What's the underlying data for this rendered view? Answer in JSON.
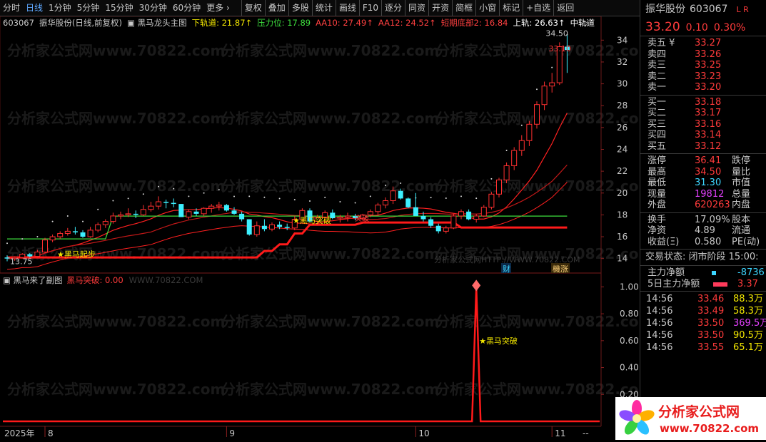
{
  "toolbar": {
    "left": [
      "分时",
      "日线",
      "1分钟",
      "5分钟",
      "15分钟",
      "30分钟",
      "60分钟",
      "更多 ›"
    ],
    "right": [
      "复权",
      "叠加",
      "多股",
      "统计",
      "画线",
      "F10",
      "逐分",
      "同资",
      "开资",
      "简框",
      "小窗",
      "标记",
      "+自选",
      "返回"
    ]
  },
  "main": {
    "code": "603067",
    "header_parts": [
      {
        "t": "603067",
        "c": "#c8c8c8"
      },
      {
        "t": "振华股份(日线,前复权)",
        "c": "#c8c8c8"
      },
      {
        "t": "▣ 黑马龙头主图",
        "c": "#c8c8c8"
      },
      {
        "t": "下轨道: 21.87↑",
        "c": "#f2e600"
      },
      {
        "t": "压力位: 17.89",
        "c": "#3ee03e"
      },
      {
        "t": "AA10: 27.49↑",
        "c": "#ff4040"
      },
      {
        "t": "AA12: 24.52↑",
        "c": "#ff4040"
      },
      {
        "t": "短期底部2: 16.84",
        "c": "#ff4040"
      },
      {
        "t": "上轨: 26.63↑",
        "c": "#ffffff"
      },
      {
        "t": "中轨道",
        "c": "#ffffff"
      }
    ],
    "y_ticks": [
      34,
      32,
      30,
      28,
      26,
      24,
      22,
      20,
      18,
      16,
      14
    ],
    "labels": {
      "high": "34.50",
      "low": "13.75",
      "last": "33.10",
      "qibu": "★黑马起步",
      "tupo": "★黑马突破",
      "tupo2": "突破",
      "site": "分析家公式网HTTP://WWW.70822.COM",
      "cai": "财",
      "zhang": "機涨"
    }
  },
  "sub": {
    "title": "▣ 黑马来了副图",
    "value_label": "黑马突破: 0.00",
    "site": "WWW.70822.COM",
    "y_ticks": [
      "1.00",
      "0.80",
      "0.60",
      "0.40",
      "0.20"
    ],
    "signal_label": "★黑马突破"
  },
  "xaxis": {
    "year": "2025年",
    "months": [
      "8",
      "9",
      "10",
      "11"
    ],
    "right": "--"
  },
  "watermark": "分析家公式网www.70822.com",
  "chart_data": {
    "type": "candlestick",
    "x_range_note": "2025年 8月-11月 日线",
    "ylim": [
      13,
      35
    ],
    "candles": [
      [
        14.1,
        14.3,
        13.75,
        14.0
      ],
      [
        14.0,
        14.2,
        13.8,
        14.1
      ],
      [
        14.1,
        14.5,
        14.0,
        14.4
      ],
      [
        14.4,
        14.5,
        14.1,
        14.2
      ],
      [
        14.2,
        14.8,
        14.1,
        14.6
      ],
      [
        14.6,
        15.9,
        14.5,
        15.7
      ],
      [
        15.7,
        16.2,
        15.5,
        16.0
      ],
      [
        16.0,
        16.5,
        15.8,
        16.3
      ],
      [
        16.3,
        16.8,
        16.1,
        16.5
      ],
      [
        16.5,
        16.9,
        16.2,
        16.4
      ],
      [
        16.4,
        16.6,
        15.9,
        16.0
      ],
      [
        16.0,
        16.9,
        15.9,
        16.6
      ],
      [
        16.6,
        17.3,
        16.4,
        17.1
      ],
      [
        17.1,
        17.6,
        16.8,
        17.4
      ],
      [
        17.4,
        18.2,
        17.2,
        17.9
      ],
      [
        17.9,
        18.3,
        17.6,
        18.0
      ],
      [
        18.0,
        18.6,
        17.8,
        18.1
      ],
      [
        18.1,
        18.4,
        17.7,
        18.0
      ],
      [
        18.0,
        18.9,
        17.9,
        18.5
      ],
      [
        18.5,
        19.2,
        18.3,
        18.8
      ],
      [
        18.8,
        19.7,
        18.5,
        19.2
      ],
      [
        19.2,
        19.4,
        18.6,
        19.1
      ],
      [
        19.1,
        19.5,
        18.7,
        19.0
      ],
      [
        19.0,
        19.0,
        17.8,
        17.8
      ],
      [
        17.8,
        18.5,
        17.6,
        18.3
      ],
      [
        18.3,
        18.6,
        17.9,
        18.1
      ],
      [
        18.1,
        18.7,
        17.9,
        18.6
      ],
      [
        18.6,
        19.0,
        18.2,
        18.8
      ],
      [
        18.8,
        19.2,
        18.4,
        18.9
      ],
      [
        18.9,
        19.0,
        18.3,
        18.4
      ],
      [
        18.4,
        18.7,
        18.0,
        18.1
      ],
      [
        18.1,
        18.3,
        17.4,
        17.6
      ],
      [
        17.6,
        17.6,
        16.1,
        16.2
      ],
      [
        16.2,
        17.4,
        16.0,
        17.0
      ],
      [
        17.0,
        17.6,
        16.5,
        16.7
      ],
      [
        16.7,
        17.3,
        16.5,
        17.1
      ],
      [
        17.1,
        17.4,
        16.7,
        16.9
      ],
      [
        16.9,
        17.2,
        16.6,
        16.8
      ],
      [
        16.8,
        17.9,
        16.6,
        17.6
      ],
      [
        17.6,
        18.6,
        17.4,
        18.4
      ],
      [
        18.4,
        18.6,
        17.3,
        17.4
      ],
      [
        17.4,
        18.0,
        17.1,
        17.8
      ],
      [
        17.8,
        18.4,
        17.5,
        18.2
      ],
      [
        18.2,
        18.5,
        17.6,
        17.7
      ],
      [
        17.7,
        18.0,
        17.3,
        17.8
      ],
      [
        17.8,
        18.2,
        17.4,
        17.9
      ],
      [
        17.9,
        18.1,
        17.5,
        17.7
      ],
      [
        17.7,
        18.1,
        17.5,
        18.0
      ],
      [
        18.0,
        18.5,
        17.8,
        18.3
      ],
      [
        18.3,
        19.1,
        18.0,
        18.9
      ],
      [
        18.9,
        19.6,
        18.6,
        19.3
      ],
      [
        19.3,
        20.6,
        19.0,
        20.2
      ],
      [
        20.2,
        20.4,
        19.4,
        19.5
      ],
      [
        19.5,
        19.6,
        18.6,
        18.7
      ],
      [
        18.7,
        20.0,
        18.0,
        17.9
      ],
      [
        17.9,
        18.3,
        17.4,
        17.6
      ],
      [
        17.6,
        17.8,
        16.8,
        17.0
      ],
      [
        17.0,
        17.2,
        16.3,
        16.5
      ],
      [
        16.5,
        17.0,
        16.3,
        16.8
      ],
      [
        16.8,
        18.1,
        16.7,
        17.9
      ],
      [
        17.9,
        18.5,
        17.6,
        18.3
      ],
      [
        18.3,
        18.5,
        17.5,
        17.6
      ],
      [
        17.6,
        18.1,
        17.3,
        17.9
      ],
      [
        17.9,
        18.9,
        17.8,
        18.7
      ],
      [
        18.7,
        20.1,
        18.5,
        19.9
      ],
      [
        19.9,
        21.4,
        19.6,
        21.2
      ],
      [
        21.2,
        22.8,
        20.9,
        22.5
      ],
      [
        22.5,
        24.2,
        22.1,
        23.9
      ],
      [
        23.9,
        25.3,
        23.4,
        24.8
      ],
      [
        24.8,
        26.6,
        24.3,
        26.3
      ],
      [
        26.3,
        28.4,
        25.9,
        28.1
      ],
      [
        28.1,
        30.2,
        27.6,
        29.8
      ],
      [
        29.8,
        31.0,
        29.2,
        30.1
      ],
      [
        30.1,
        33.8,
        29.9,
        33.4
      ],
      [
        33.4,
        34.5,
        31.0,
        33.1
      ]
    ],
    "series": [
      {
        "name": "下轨道",
        "value_last": 21.87
      },
      {
        "name": "压力位",
        "value_last": 17.89
      },
      {
        "name": "AA10",
        "value_last": 27.49
      },
      {
        "name": "AA12",
        "value_last": 24.52
      },
      {
        "name": "短期底部2",
        "value_last": 16.84
      },
      {
        "name": "上轨",
        "value_last": 26.63
      }
    ],
    "sub_chart": {
      "name": "黑马突破",
      "spike_index": 62,
      "spike_value": 1.0,
      "ylim": [
        0,
        1.05
      ]
    }
  },
  "panel": {
    "name": "振华股份",
    "code": "603067",
    "price": "33.20",
    "change": "0.10",
    "pct": "0.30%",
    "asks": [
      [
        "卖五 ¥",
        "33.27"
      ],
      [
        "卖四",
        "33.26"
      ],
      [
        "卖三",
        "33.25"
      ],
      [
        "卖二",
        "33.23"
      ],
      [
        "卖一",
        "33.20"
      ]
    ],
    "bids": [
      [
        "买一",
        "33.18"
      ],
      [
        "买二",
        "33.17"
      ],
      [
        "买三",
        "33.16"
      ],
      [
        "买四",
        "33.14"
      ],
      [
        "买五",
        "33.12"
      ]
    ],
    "stats1": [
      {
        "l": "涨停",
        "v": "36.41",
        "vc": "red",
        "r": "跌停"
      },
      {
        "l": "最高",
        "v": "34.50",
        "vc": "red",
        "r": "量比"
      },
      {
        "l": "最低",
        "v": "31.30",
        "vc": "cyan",
        "r": "市值"
      },
      {
        "l": "现量",
        "v": "19812",
        "vc": "magenta",
        "r": "总量"
      },
      {
        "l": "外盘",
        "v": "620263",
        "vc": "red",
        "r": "内盘"
      }
    ],
    "stats2": [
      {
        "l": "换手",
        "v": "17.09%",
        "vc": "",
        "r": "股本"
      },
      {
        "l": "净资",
        "v": "4.89",
        "vc": "",
        "r": "流通"
      },
      {
        "l": "收益(Ξ)",
        "v": "0.580",
        "vc": "",
        "r": "PE(动)"
      }
    ],
    "status": "交易状态: 闭市阶段 15:00:",
    "flow": [
      {
        "l": "主力净额",
        "v": "-8736",
        "vc": "cyan"
      },
      {
        "l": "5日主力净额",
        "v": "3.37",
        "vc": "red"
      }
    ],
    "ticks": [
      [
        "14:56",
        "33.46",
        "88.3万",
        "yellow"
      ],
      [
        "14:56",
        "33.49",
        "58.3万",
        "yellow"
      ],
      [
        "14:56",
        "33.50",
        "369.5万",
        "magenta"
      ],
      [
        "14:56",
        "33.50",
        "90.5万",
        "yellow"
      ],
      [
        "14:56",
        "33.55",
        "65.1万",
        "yellow"
      ]
    ]
  },
  "logo": {
    "text": "分析家公式网",
    "url": "www.70822.com"
  }
}
